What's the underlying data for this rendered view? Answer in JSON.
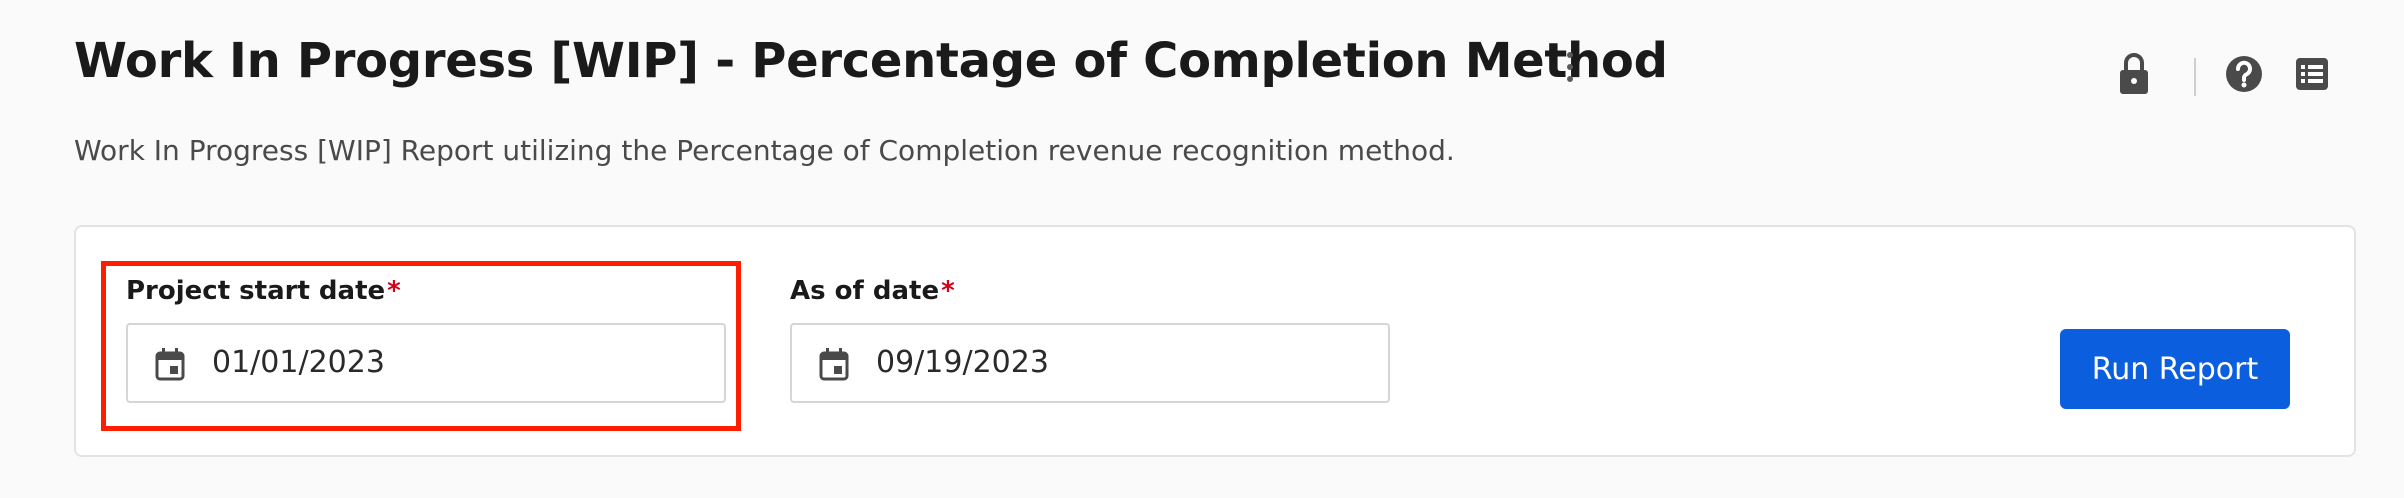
{
  "header": {
    "title": "Work In Progress [WIP] - Percentage of Completion Method",
    "more_icon": "more-vertical-icon",
    "icons": [
      "lock-icon",
      "help-circle-icon",
      "list-icon"
    ]
  },
  "subtitle": "Work In Progress [WIP] Report utilizing the Percentage of Completion revenue recognition method.",
  "form": {
    "project_start": {
      "label": "Project start date",
      "required_mark": "*",
      "value": "01/01/2023",
      "icon": "calendar-icon"
    },
    "as_of": {
      "label": "As of date",
      "required_mark": "*",
      "value": "09/19/2023",
      "icon": "calendar-icon"
    },
    "run_button_label": "Run Report"
  },
  "colors": {
    "primary": "#0b5ede",
    "required": "#d0021b",
    "highlight": "#ff1f00",
    "background": "#fafafa"
  }
}
